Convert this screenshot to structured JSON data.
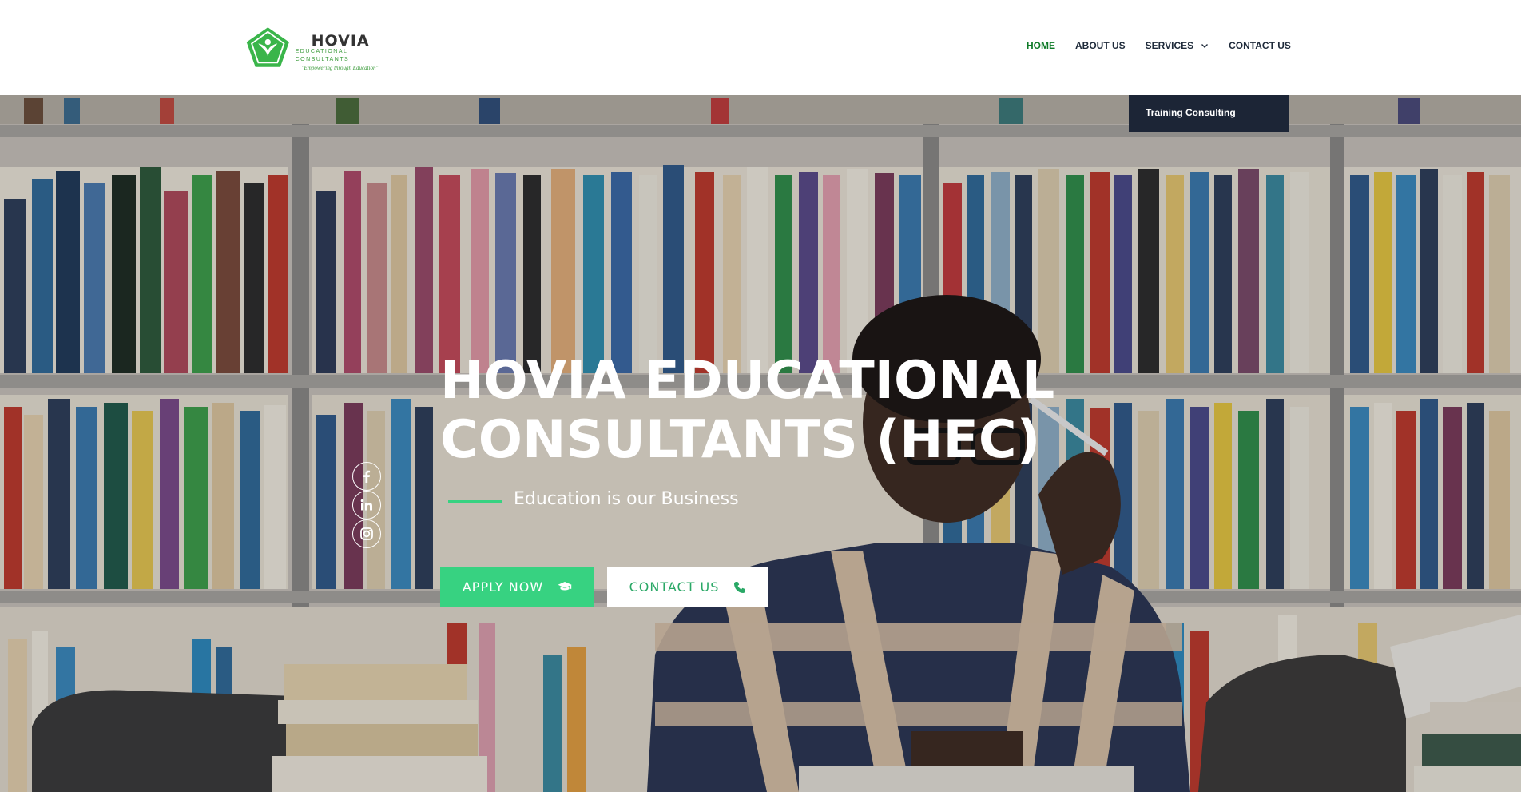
{
  "brand": {
    "name": "HOVIA",
    "subtitle": "EDUCATIONAL CONSULTANTS",
    "tagline": "\"Empowering through Education\"",
    "green": "#3ab54a"
  },
  "nav": {
    "items": [
      {
        "label": "HOME",
        "active": true
      },
      {
        "label": "ABOUT US",
        "active": false
      },
      {
        "label": "SERVICES",
        "active": false,
        "has_dropdown": true
      },
      {
        "label": "CONTACT US",
        "active": false
      }
    ],
    "dropdown": {
      "items": [
        "Training Consulting"
      ]
    }
  },
  "hero": {
    "title_line1": "HOVIA EDUCATIONAL",
    "title_line2": "CONSULTANTS (HEC)",
    "subtitle": "Education is our Business",
    "apply_label": "APPLY NOW",
    "contact_label": "CONTACT US",
    "accent": "#37d281"
  },
  "social": [
    "facebook-icon",
    "linkedin-icon",
    "instagram-icon"
  ]
}
